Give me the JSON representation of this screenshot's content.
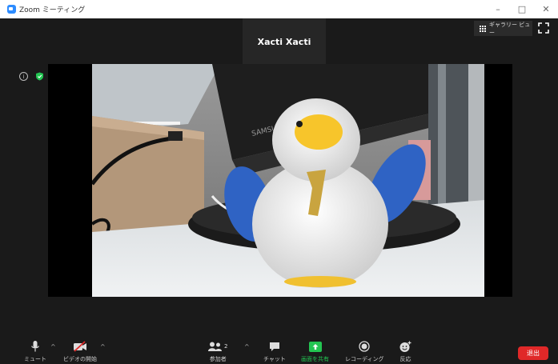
{
  "window": {
    "title": "Zoom ミーティング",
    "controls": [
      "–",
      "□",
      "✕"
    ]
  },
  "meeting": {
    "speaker_name": "Xacti Xacti",
    "view_label": "ギャラリー ビュー"
  },
  "toolbar": {
    "mute_label": "ミュート",
    "video_label": "ビデオの開始",
    "participants_label": "参加者",
    "participants_count": "2",
    "chat_label": "チャット",
    "share_label": "画面を共有",
    "record_label": "レコーディング",
    "reactions_label": "反応",
    "leave_label": "退出"
  },
  "colors": {
    "accent": "#2d8cff",
    "share_green": "#23c552",
    "leave_red": "#e02828"
  }
}
